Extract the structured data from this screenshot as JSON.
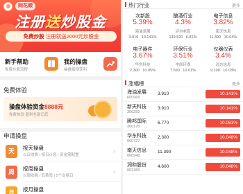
{
  "banner": {
    "brand": "同花顺",
    "slogan_a": "注册",
    "slogan_hl": "送",
    "slogan_b": "炒股金",
    "sub_a": "免费炒股",
    "sub_b": "注册就送2000元炒股金"
  },
  "quick": [
    {
      "title": "新手帮助",
      "sub": "免费炒股流程",
      "icon": "book-icon"
    },
    {
      "title": "我的操盘",
      "sub": "操盘细项获利",
      "icon": "chart-icon"
    }
  ],
  "free": {
    "title": "免费体验",
    "banner_a": "操盘体验资金",
    "banner_amt": "8888元",
    "banner_sub": "免费体验 盈利全部归您"
  },
  "apply": {
    "title": "申请操盘",
    "items": [
      {
        "icon_text": "天",
        "icon_color": "#f58a2c",
        "title": "按天操盘",
        "sub": "以日收费 | 按日计息 | 资金需配置"
      },
      {
        "icon_text": "周",
        "icon_color": "#f06a4d",
        "title": "按周操盘",
        "sub": "以周收费 | 低费率 | 5个交易日"
      },
      {
        "icon_text": "月",
        "icon_color": "#f5a623",
        "title": "按月操盘",
        "sub": ""
      }
    ]
  },
  "hot": {
    "title": "热门行业",
    "more": "更多",
    "cells": [
      {
        "name": "次新股",
        "pct": "5.39%",
        "leader": "海油发展",
        "vals": "3.910 10.141%"
      },
      {
        "name": "酿酒行业",
        "pct": "4.3%",
        "leader": "泸州老窖",
        "vals": "139.520 6.81%"
      },
      {
        "name": "电子信息",
        "pct": "3.82%",
        "leader": "南天信息",
        "vals": "11.390 10.04%"
      },
      {
        "name": "电子器件",
        "pct": "3.67%",
        "leader": "华东科技",
        "vals": "2.300 10.05%"
      },
      {
        "name": "环保行业",
        "pct": "3.51%",
        "leader": "中原环保",
        "vals": "7.590 10.01%"
      },
      {
        "name": "仪器仪表",
        "pct": "3.4%",
        "leader": "远方信息",
        "vals": "9.100 10.03%"
      }
    ]
  },
  "gainers": {
    "title": "涨幅榜",
    "more": "更多",
    "rows": [
      {
        "name": "海油发展",
        "code": "600968",
        "price": "3.910",
        "chg": "10.141%"
      },
      {
        "name": "新天科技",
        "code": "300259",
        "price": "3.910",
        "chg": "10.141%"
      },
      {
        "name": "腾邦国际",
        "code": "300178",
        "price": "6.770",
        "chg": "10.081%"
      },
      {
        "name": "华东科技",
        "code": "000727",
        "price": "2.300",
        "chg": "10.048%"
      },
      {
        "name": "南天信息",
        "code": "000948",
        "price": "11.390",
        "chg": "10.048%"
      },
      {
        "name": "润和股份",
        "code": "002483",
        "price": "4.600",
        "chg": "10.048%"
      }
    ]
  },
  "colors": {
    "accent": "#e2352e",
    "rise": "#f04a3c"
  }
}
